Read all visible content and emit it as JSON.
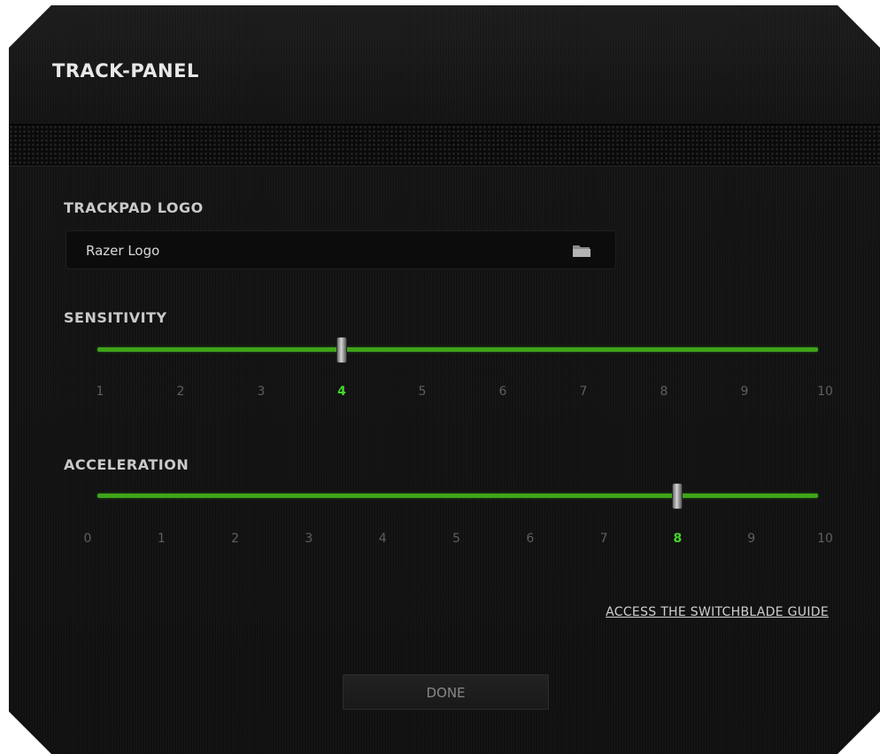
{
  "dialog": {
    "title": "TRACK-PANEL"
  },
  "trackpad_logo": {
    "label": "TRACKPAD LOGO",
    "value": "Razer Logo",
    "icon": "folder-icon"
  },
  "sensitivity": {
    "label": "SENSITIVITY",
    "value": 4,
    "min": 1,
    "max": 10,
    "ticks": [
      "1",
      "2",
      "3",
      "4",
      "5",
      "6",
      "7",
      "8",
      "9",
      "10"
    ]
  },
  "acceleration": {
    "label": "ACCELERATION",
    "value": 8,
    "min": 0,
    "max": 10,
    "ticks": [
      "0",
      "1",
      "2",
      "3",
      "4",
      "5",
      "6",
      "7",
      "8",
      "9",
      "10"
    ]
  },
  "guide_link": "ACCESS THE SWITCHBLADE GUIDE",
  "done_button": "DONE",
  "colors": {
    "accent": "#44d62c",
    "track": "#3fa41a",
    "background": "#121212",
    "text": "#c9c9c9",
    "inactive_tick": "#5f5f5f"
  }
}
